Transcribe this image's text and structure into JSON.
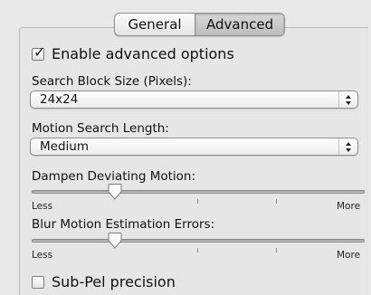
{
  "tabs": {
    "general": "General",
    "advanced": "Advanced",
    "selected": "Advanced"
  },
  "enable_advanced": {
    "label": "Enable advanced options",
    "checked": true
  },
  "search_block": {
    "label": "Search Block Size (Pixels):",
    "value": "24x24"
  },
  "motion_search": {
    "label": "Motion Search Length:",
    "value": "Medium"
  },
  "dampen": {
    "label": "Dampen Deviating Motion:",
    "min_label": "Less",
    "max_label": "More",
    "value_fraction": 0.25
  },
  "blur": {
    "label": "Blur Motion Estimation Errors:",
    "min_label": "Less",
    "max_label": "More",
    "value_fraction": 0.25
  },
  "subpel": {
    "label": "Sub-Pel precision",
    "checked": false
  }
}
